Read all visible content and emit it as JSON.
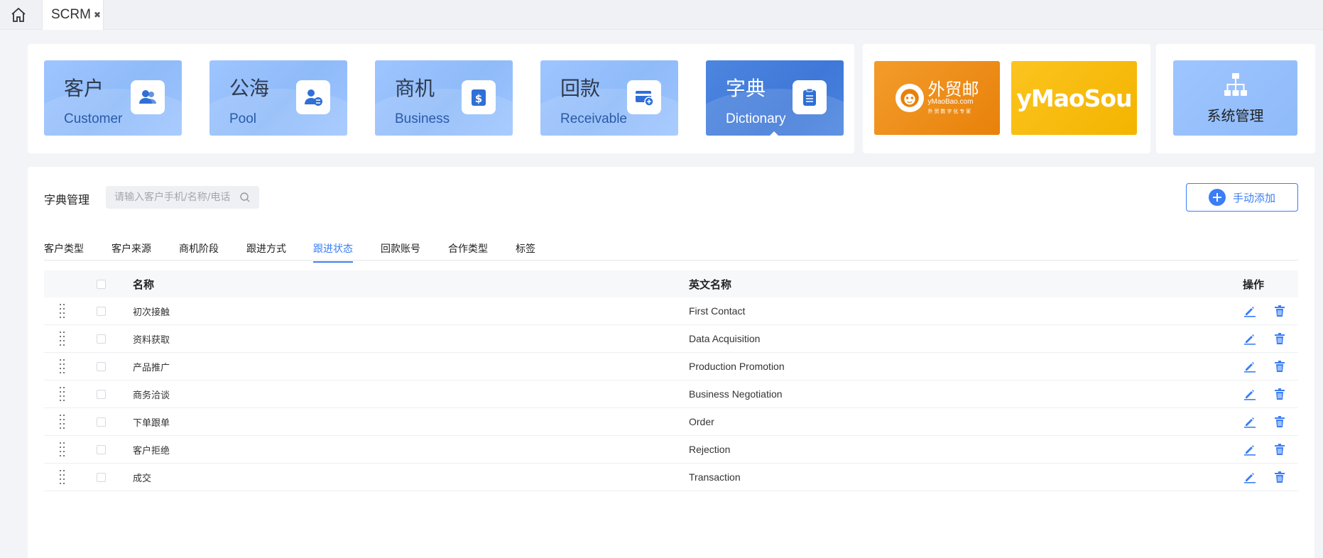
{
  "topbar": {
    "tab_label": "SCRM",
    "close": "✖"
  },
  "modules": [
    {
      "zh": "客户",
      "en": "Customer",
      "icon": "users-icon"
    },
    {
      "zh": "公海",
      "en": "Pool",
      "icon": "user-exchange-icon"
    },
    {
      "zh": "商机",
      "en": "Business",
      "icon": "dollar-document-icon"
    },
    {
      "zh": "回款",
      "en": "Receivable",
      "icon": "card-return-icon"
    },
    {
      "zh": "字典",
      "en": "Dictionary",
      "icon": "clipboard-icon",
      "active": true
    }
  ],
  "brands": {
    "ymaobao": {
      "title": "外贸邮",
      "domain": "yMaoBao.com",
      "tagline": "外 贸 数 字 化 专 家"
    },
    "ymaosou": {
      "title": "yMaoSou"
    }
  },
  "system": {
    "label": "系统管理",
    "icon": "org-chart-icon"
  },
  "page": {
    "title": "字典管理",
    "search_placeholder": "请输入客户手机/名称/电话",
    "add_button": "手动添加"
  },
  "tabs": [
    {
      "label": "客户类型"
    },
    {
      "label": "客户来源"
    },
    {
      "label": "商机阶段"
    },
    {
      "label": "跟进方式"
    },
    {
      "label": "跟进状态",
      "active": true
    },
    {
      "label": "回款账号"
    },
    {
      "label": "合作类型"
    },
    {
      "label": "标签"
    }
  ],
  "table": {
    "headers": {
      "name": "名称",
      "en_name": "英文名称",
      "actions": "操作"
    },
    "rows": [
      {
        "name": "初次接触",
        "en_name": "First Contact"
      },
      {
        "name": "资料获取",
        "en_name": "Data Acquisition"
      },
      {
        "name": "产品推广",
        "en_name": "Production Promotion"
      },
      {
        "name": "商务洽谈",
        "en_name": "Business Negotiation"
      },
      {
        "name": "下单跟单",
        "en_name": "Order"
      },
      {
        "name": "客户拒绝",
        "en_name": "Rejection"
      },
      {
        "name": "成交",
        "en_name": "Transaction"
      }
    ]
  },
  "colors": {
    "accent": "#3b7ef5",
    "card": "#9ec5ff",
    "card_active": "#4a84de",
    "brand_orange": "#e8810a",
    "brand_yellow": "#f4b400"
  }
}
